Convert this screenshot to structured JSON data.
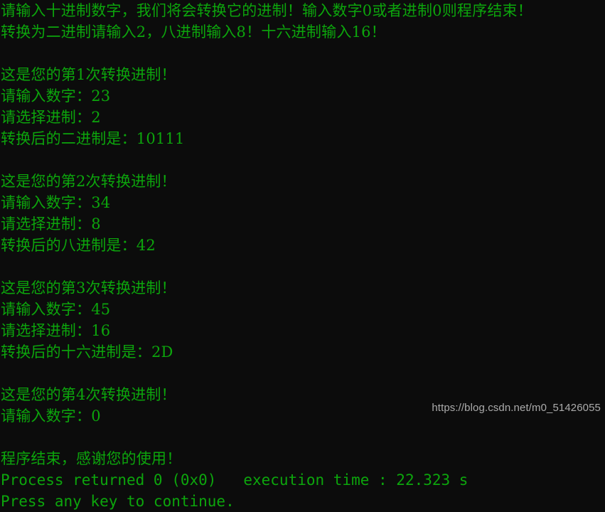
{
  "window": {
    "type": "windows-console",
    "background_color": "#0c0c0c",
    "text_color": "#0ca50c",
    "watermark_color": "#b9b9b9"
  },
  "console": {
    "lines": [
      {
        "text": "请输入十进制数字，我们将会转换它的进制！输入数字0或者进制0则程序结束！",
        "cjk": true
      },
      {
        "text": "转换为二进制请输入2，八进制输入8！十六进制输入16！",
        "cjk": true
      },
      {
        "text": "",
        "cjk": false
      },
      {
        "text": "这是您的第1次转换进制！",
        "cjk": true
      },
      {
        "text": "请输入数字：23",
        "cjk": true
      },
      {
        "text": "请选择进制：2",
        "cjk": true
      },
      {
        "text": "转换后的二进制是：10111",
        "cjk": true
      },
      {
        "text": "",
        "cjk": false
      },
      {
        "text": "这是您的第2次转换进制！",
        "cjk": true
      },
      {
        "text": "请输入数字：34",
        "cjk": true
      },
      {
        "text": "请选择进制：8",
        "cjk": true
      },
      {
        "text": "转换后的八进制是：42",
        "cjk": true
      },
      {
        "text": "",
        "cjk": false
      },
      {
        "text": "这是您的第3次转换进制！",
        "cjk": true
      },
      {
        "text": "请输入数字：45",
        "cjk": true
      },
      {
        "text": "请选择进制：16",
        "cjk": true
      },
      {
        "text": "转换后的十六进制是：2D",
        "cjk": true
      },
      {
        "text": "",
        "cjk": false
      },
      {
        "text": "这是您的第4次转换进制！",
        "cjk": true
      },
      {
        "text": "请输入数字：0",
        "cjk": true
      },
      {
        "text": "",
        "cjk": false
      },
      {
        "text": "程序结束，感谢您的使用！",
        "cjk": true
      },
      {
        "text": "Process returned 0 (0x0)   execution time : 22.323 s",
        "cjk": false
      },
      {
        "text": "Press any key to continue.",
        "cjk": false
      }
    ],
    "exit": {
      "return_code": "0",
      "return_code_hex": "0x0",
      "execution_time": "22.323 s",
      "prompt": "Press any key to continue."
    },
    "conversions": [
      {
        "index": "1",
        "number": "23",
        "base": "2",
        "base_name": "二进制",
        "result": "10111"
      },
      {
        "index": "2",
        "number": "34",
        "base": "8",
        "base_name": "八进制",
        "result": "42"
      },
      {
        "index": "3",
        "number": "45",
        "base": "16",
        "base_name": "十六进制",
        "result": "2D"
      },
      {
        "index": "4",
        "number": "0",
        "base": "",
        "base_name": "",
        "result": ""
      }
    ]
  },
  "watermark": {
    "text": "https://blog.csdn.net/m0_51426055"
  }
}
